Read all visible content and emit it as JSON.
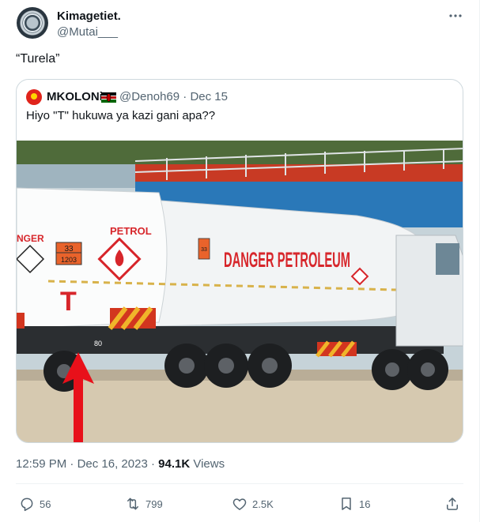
{
  "author": {
    "name": "Kimagetiet.",
    "handle": "@Mutai___"
  },
  "tweet_text": "“Turela”",
  "quoted": {
    "name": "MKOLONi",
    "handle": "@Denoh69",
    "separator": "·",
    "date": "Dec 15",
    "text": "Hiyo \"T\" hukuwa ya kazi gani apa??",
    "image": {
      "truck_label_petrol": "PETROL",
      "truck_hazard_code_top": "33",
      "truck_hazard_code_bottom": "1203",
      "truck_big_letter": "T",
      "truck_side_text": "DANGER PETROLEUM",
      "truck_side_code": "33",
      "rear_left_text": "NGER",
      "number_plate_fragment": "80"
    }
  },
  "meta": {
    "time": "12:59 PM",
    "dot": "·",
    "date": "Dec 16, 2023",
    "views_count": "94.1K",
    "views_label": "Views"
  },
  "actions": {
    "replies": "56",
    "retweets": "799",
    "likes": "2.5K",
    "bookmarks": "16"
  },
  "icons": {
    "more": "more-horizontal-icon",
    "reply": "reply-icon",
    "retweet": "retweet-icon",
    "like": "heart-icon",
    "bookmark": "bookmark-icon",
    "share": "share-icon"
  },
  "colors": {
    "text_primary": "#0f1419",
    "text_secondary": "#536471",
    "border": "#cfd9de",
    "tanker_red": "#d7262b",
    "arrow_red": "#e8101a"
  }
}
